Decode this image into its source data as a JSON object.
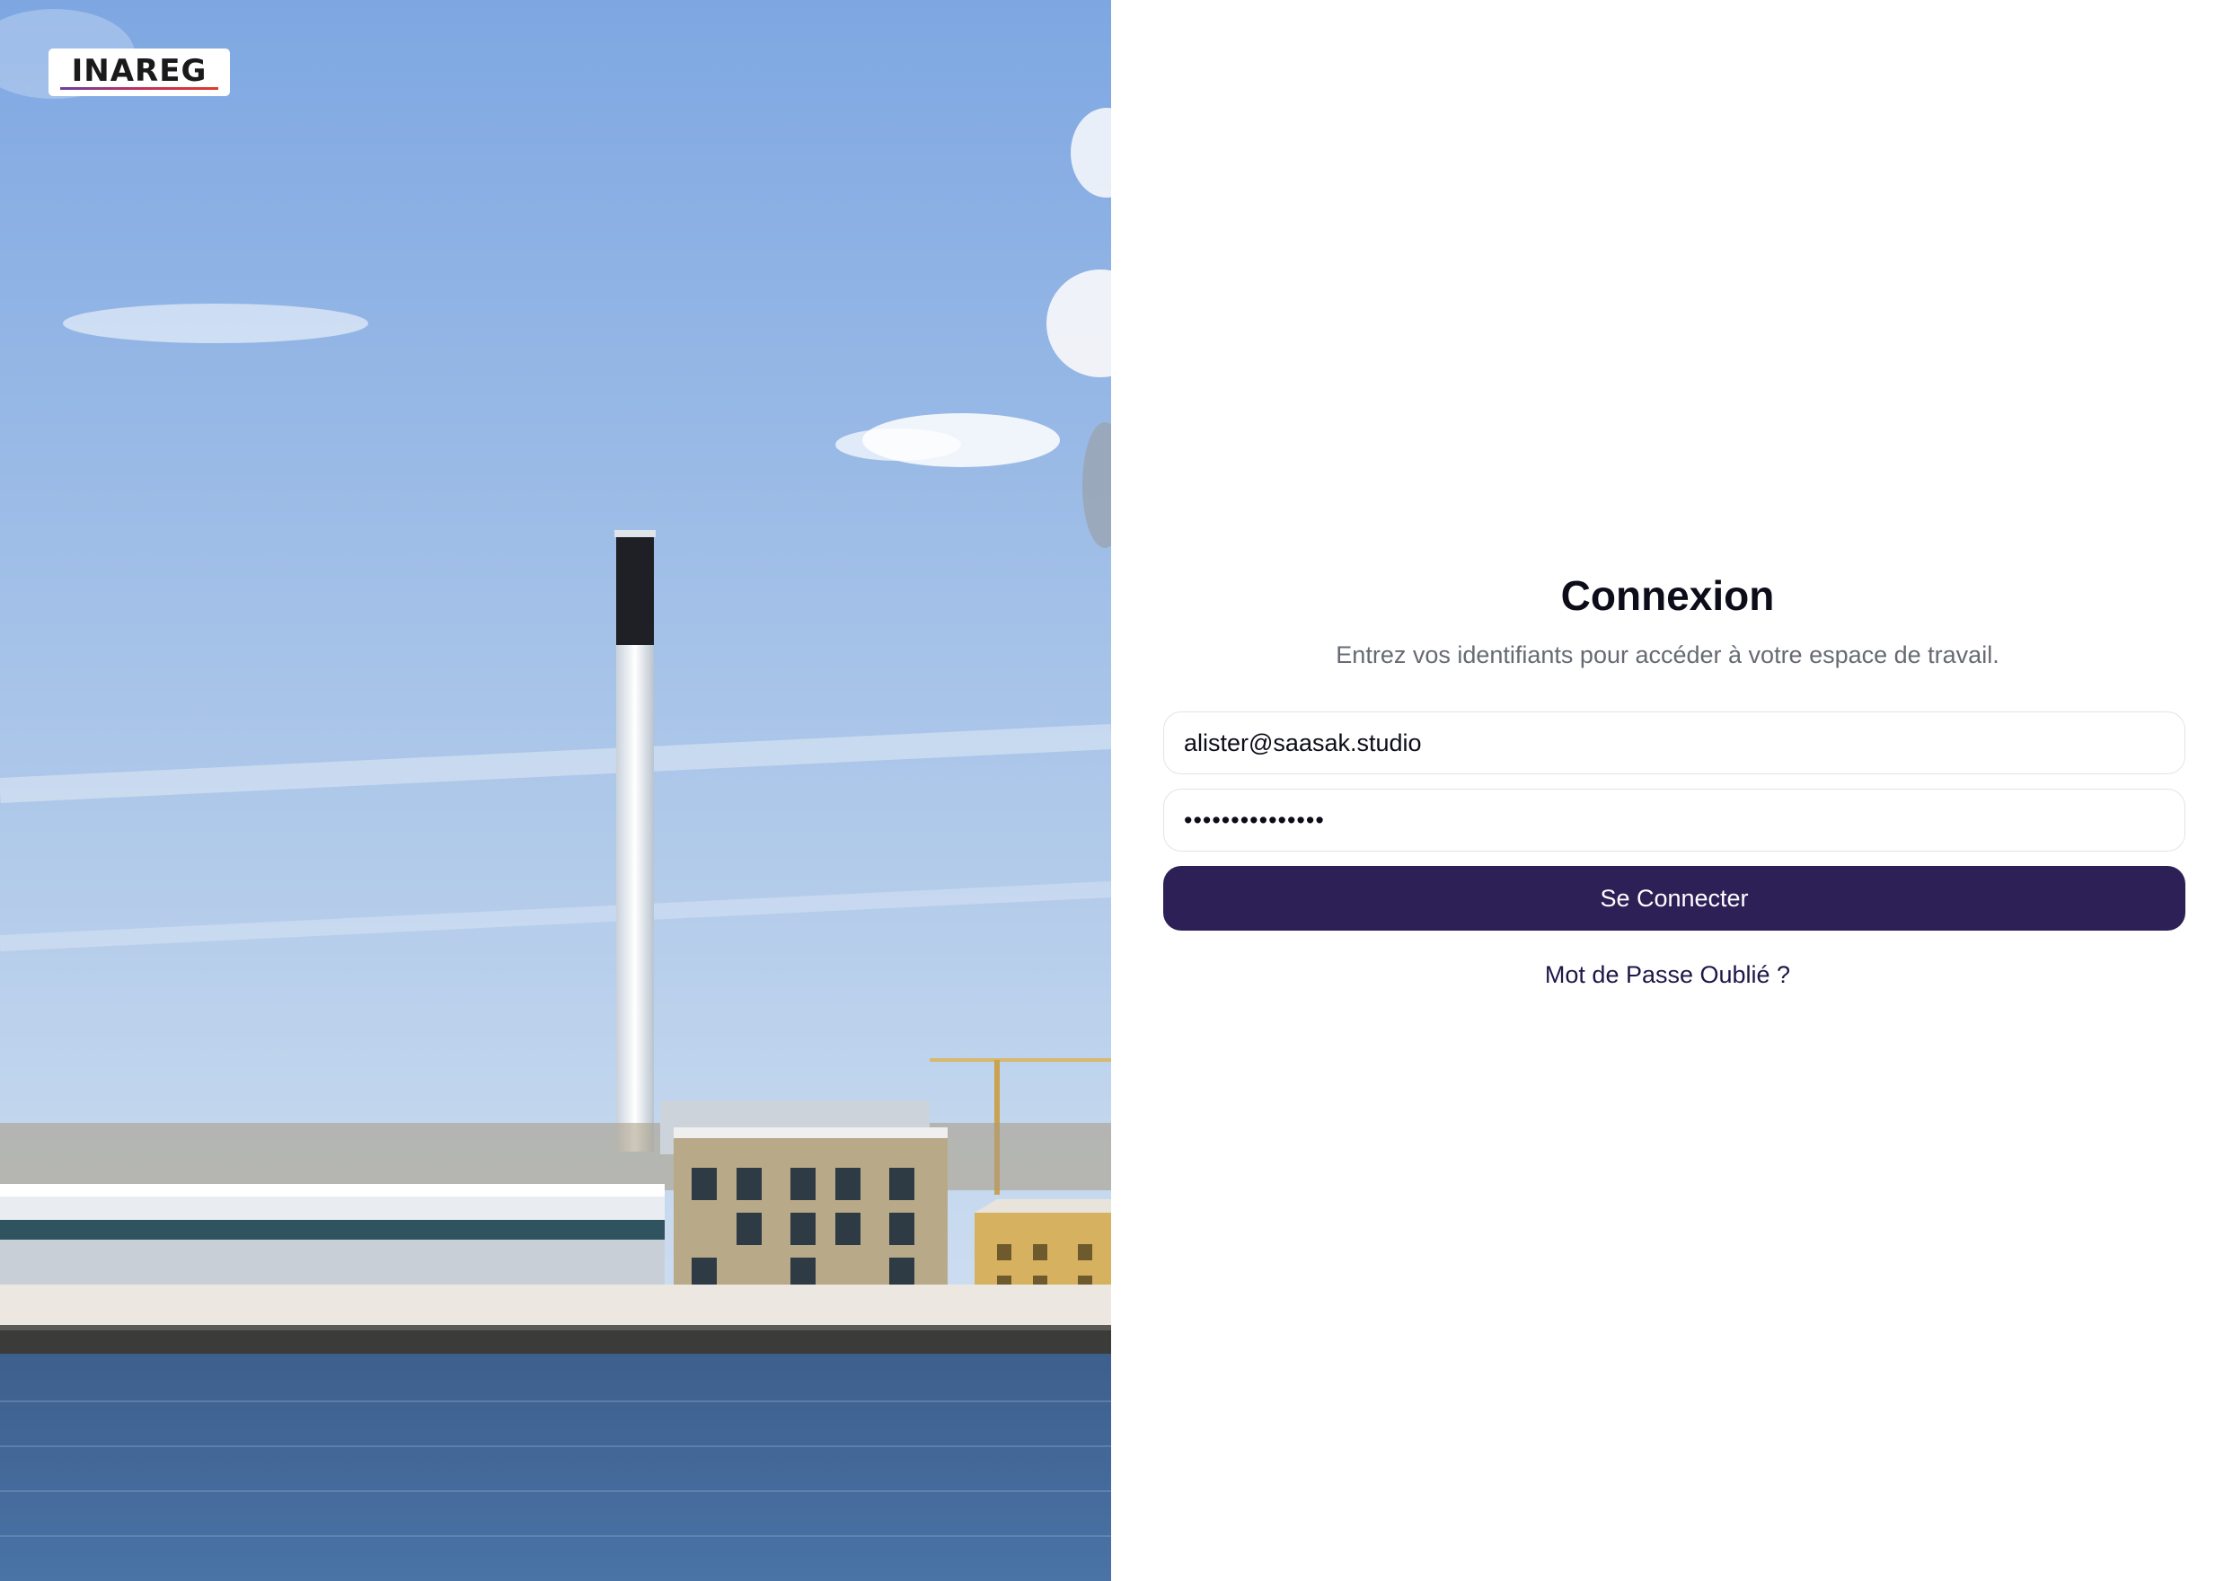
{
  "brand": {
    "logo_text": "INAREG"
  },
  "login": {
    "title": "Connexion",
    "subtitle": "Entrez vos identifiants pour accéder à votre espace de travail.",
    "email_value": "alister@saasak.studio",
    "password_mask": "•••••••••••••••",
    "submit_label": "Se Connecter",
    "forgot_label": "Mot de Passe Oublié ?"
  },
  "colors": {
    "button_bg": "#2d2057",
    "link": "#1e1748",
    "title": "#0d0d1a",
    "subtitle": "#666a72",
    "field_border": "#e3e4e8"
  }
}
